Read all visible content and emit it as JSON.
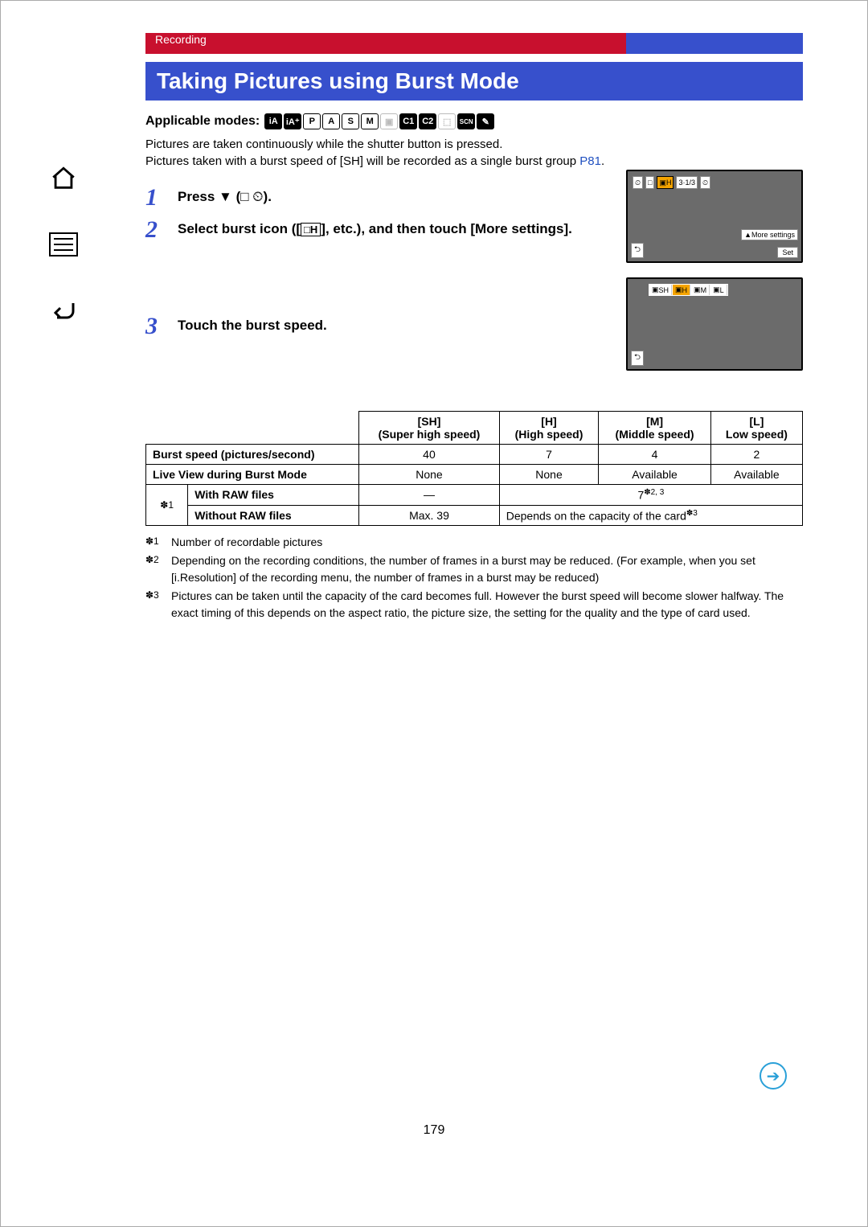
{
  "header": {
    "section": "Recording",
    "title": "Taking Pictures using Burst Mode"
  },
  "applicable_label": "Applicable modes:",
  "mode_letters": [
    "iA",
    "iA+",
    "P",
    "A",
    "S",
    "M",
    "",
    "C1",
    "C2",
    "",
    "SCN",
    ""
  ],
  "intro": {
    "line1": "Pictures are taken continuously while the shutter button is pressed.",
    "line2a": "Pictures taken with a burst speed of [SH] will be recorded as a single burst group ",
    "line2_link": "P81",
    "line2b": "."
  },
  "steps": {
    "s1": "Press ▼ (",
    "s1_icons": "□ ⏲",
    "s1_end": ").",
    "s2": "Select burst icon ([",
    "s2_icon": "□H",
    "s2_mid": "], etc.), and then touch [More settings].",
    "s3": "Touch the burst speed."
  },
  "screens": {
    "topbar_vals": [
      "3·1/3"
    ],
    "more_settings": "▲More settings",
    "set": "Set",
    "back": "⮌",
    "speeds": [
      "SH",
      "H",
      "M",
      "L"
    ]
  },
  "table": {
    "c1": "[SH]\n(Super high speed)",
    "c2": "[H]\n(High speed)",
    "c3": "[M]\n(Middle speed)",
    "c4": "[L]\nLow speed)",
    "r1": "Burst speed (pictures/second)",
    "r1v": [
      "40",
      "7",
      "4",
      "2"
    ],
    "r2": "Live View during Burst Mode",
    "r2v": [
      "None",
      "None",
      "Available",
      "Available"
    ],
    "group_mark": "✽1",
    "r3": "With RAW files",
    "r3v_dash": "—",
    "r3v_span": "7",
    "r3v_span_note": "✽2, 3",
    "r4": "Without RAW files",
    "r4v1": "Max. 39",
    "r4v_span": "Depends on the capacity of the card",
    "r4v_span_note": "✽3"
  },
  "notes": {
    "n1m": "✽1",
    "n1": "Number of recordable pictures",
    "n2m": "✽2",
    "n2": "Depending on the recording conditions, the number of frames in a burst may be reduced. (For example, when you set [i.Resolution] of the recording menu, the number of frames in a burst may be reduced)",
    "n3m": "✽3",
    "n3": "Pictures can be taken until the capacity of the card becomes full. However the burst speed will become slower halfway. The exact timing of this depends on the aspect ratio, the picture size, the setting for the quality and the type of card used."
  },
  "page_number": "179"
}
